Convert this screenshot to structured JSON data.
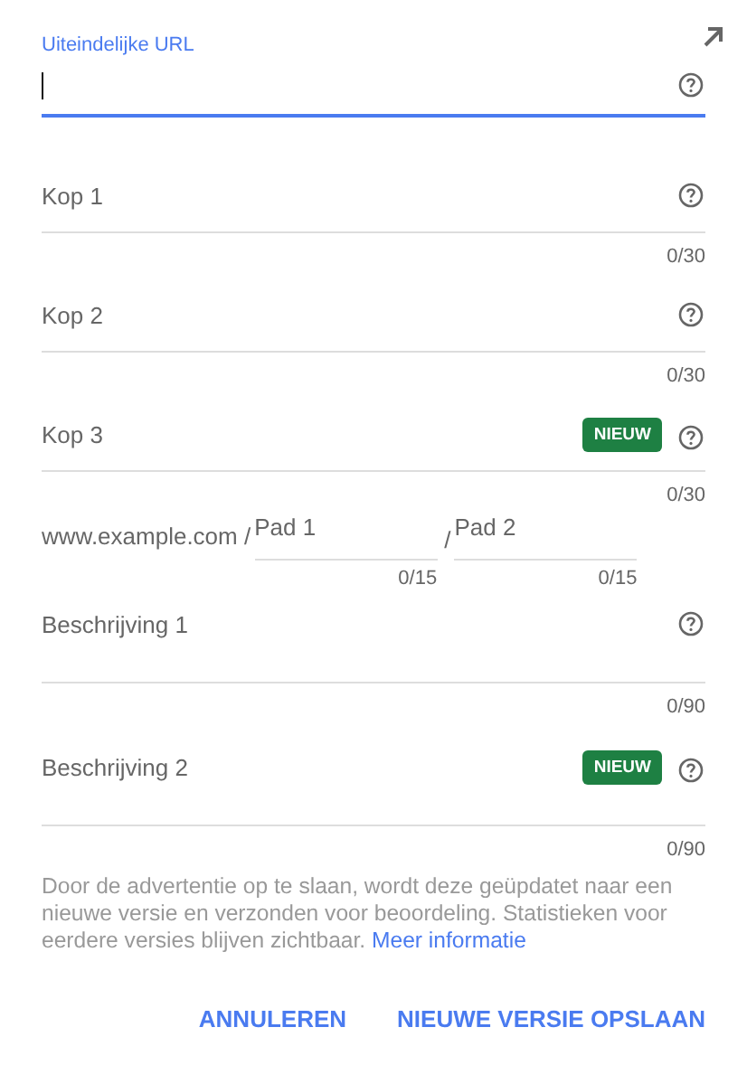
{
  "url_field": {
    "label": "Uiteindelijke URL",
    "focused": true
  },
  "fields": [
    {
      "kind": "line",
      "label": "Kop 1",
      "counter": "0/30"
    },
    {
      "kind": "line",
      "label": "Kop 2",
      "counter": "0/30"
    },
    {
      "kind": "line",
      "label": "Kop 3",
      "badge": "NIEUW",
      "counter": "0/30"
    },
    {
      "kind": "path",
      "prefix": "www.example.com /",
      "paths": [
        {
          "label": "Pad 1",
          "counter": "0/15"
        },
        {
          "label": "Pad 2",
          "counter": "0/15",
          "separator": "/"
        }
      ]
    },
    {
      "kind": "multiline",
      "label": "Beschrijving 1",
      "counter": "0/90"
    },
    {
      "kind": "multiline",
      "label": "Beschrijving 2",
      "badge": "NIEUW",
      "counter": "0/90"
    }
  ],
  "notice": {
    "text": "Door de advertentie op te slaan, wordt deze geüpdatet naar een nieuwe versie en verzonden voor beoordeling. Statistieken voor eerdere versies blijven zichtbaar.",
    "link": "Meer informatie"
  },
  "buttons": [
    "ANNULEREN",
    "NIEUWE VERSIE OPSLAAN"
  ]
}
